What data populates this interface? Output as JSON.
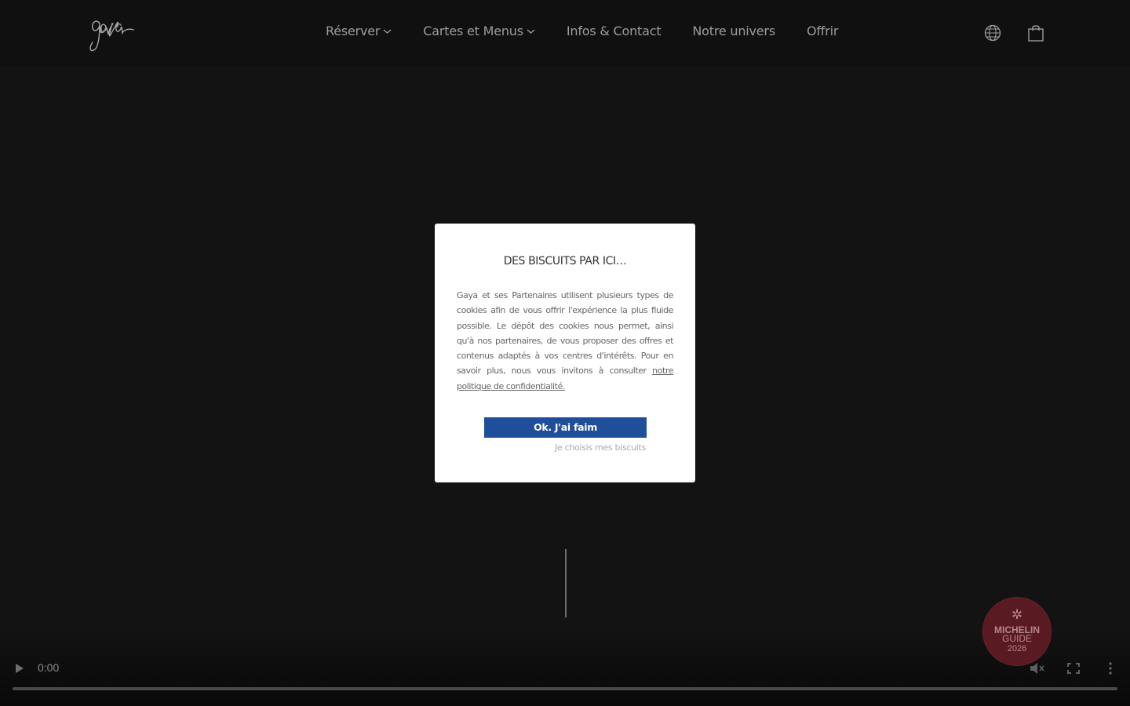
{
  "header": {
    "logo_text": "gaya",
    "nav": [
      {
        "label": "Réserver",
        "has_dropdown": true
      },
      {
        "label": "Cartes et Menus",
        "has_dropdown": true
      },
      {
        "label": "Infos & Contact",
        "has_dropdown": false
      },
      {
        "label": "Notre univers",
        "has_dropdown": false
      },
      {
        "label": "Offrir",
        "has_dropdown": false
      }
    ],
    "icons": [
      "globe-icon",
      "shopping-bag-icon"
    ]
  },
  "cookie_modal": {
    "title": "DES BISCUITS PAR ICI…",
    "body": "Gaya et ses Partenaires utilisent plusieurs types de cookies afin de vous offrir l'expérience la plus fluide possible. Le dépôt des cookies nous permet, ainsi qu'à nos partenaires, de vous proposer des offres et contenus adaptés à vos centres d'intérêts. Pour en savoir plus, nous vous invitons à consulter ",
    "policy_link": "notre politique de confidentialité.",
    "accept_label": "Ok. J'ai faim",
    "choose_label": "Je choisis mes biscuits"
  },
  "video": {
    "time": "0:00",
    "progress": 0
  },
  "michelin": {
    "line1": "MICHELIN",
    "line2": "GUIDE",
    "line3": "2026",
    "star": "✲"
  },
  "colors": {
    "background": "#131313",
    "accent_button": "#1f4e9a",
    "michelin_red": "#5a1a22"
  }
}
